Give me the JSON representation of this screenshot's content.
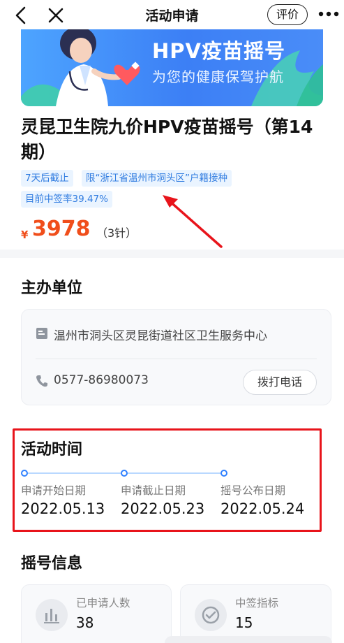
{
  "nav": {
    "title": "活动申请",
    "review_label": "评价"
  },
  "banner": {
    "title": "HPV疫苗摇号",
    "subtitle": "为您的健康保驾护航"
  },
  "activity": {
    "title": "灵昆卫生院九价HPV疫苗摇号（第14期）",
    "tags": [
      "7天后截止",
      "限“浙江省温州市洞头区”户籍接种",
      "目前中签率39.47%"
    ],
    "price_symbol": "¥",
    "price": "3978",
    "price_unit": "（3针）"
  },
  "organizer": {
    "section_title": "主办单位",
    "name": "温州市洞头区灵昆街道社区卫生服务中心",
    "phone": "0577-86980073",
    "call_label": "拨打电话"
  },
  "schedule": {
    "section_title": "活动时间",
    "steps": [
      {
        "label": "申请开始日期",
        "date": "2022.05.13"
      },
      {
        "label": "申请截止日期",
        "date": "2022.05.23"
      },
      {
        "label": "摇号公布日期",
        "date": "2022.05.24"
      }
    ]
  },
  "lottery": {
    "section_title": "摇号信息",
    "applicants_label": "已申请人数",
    "applicants_value": "38",
    "quota_label": "中签指标",
    "quota_value": "15"
  },
  "colors": {
    "accent": "#2f80ff",
    "price": "#f04e1b",
    "highlight_box": "#e8141b",
    "annotation_arrow": "#e8141b"
  }
}
